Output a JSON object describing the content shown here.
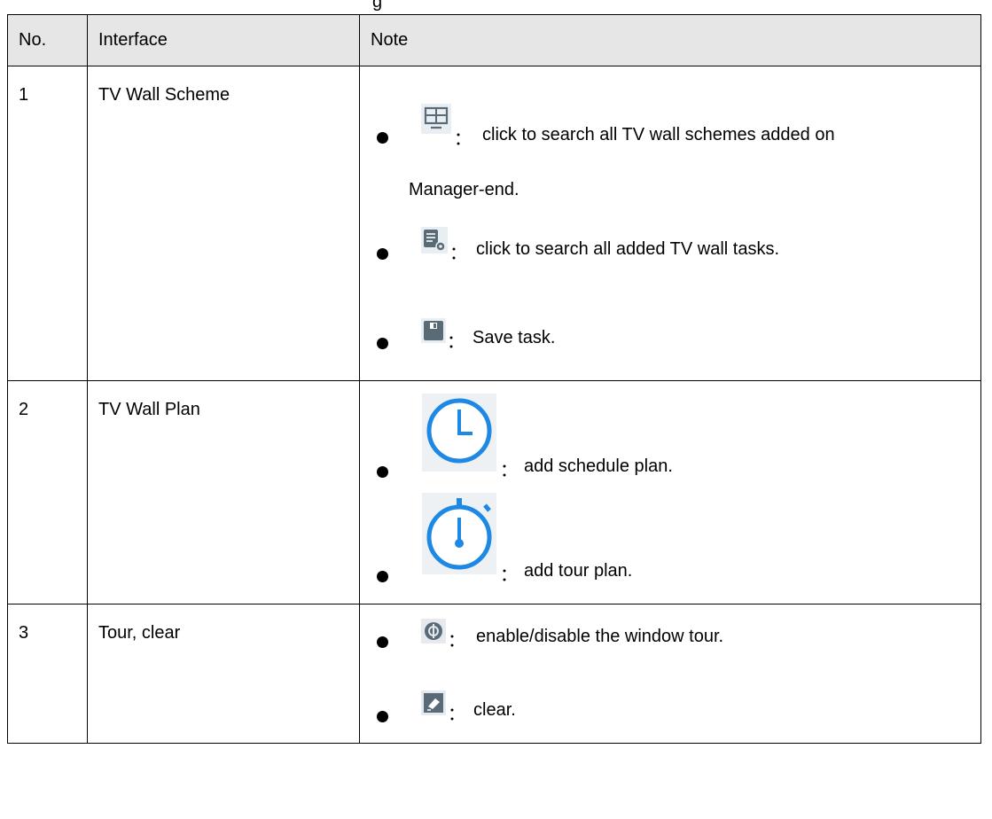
{
  "caption_fragment": "g",
  "headers": {
    "no": "No.",
    "interface": "Interface",
    "note": "Note"
  },
  "rows": [
    {
      "no": "1",
      "interface": "TV Wall Scheme",
      "items": [
        {
          "icon": "tv-wall-scheme-icon",
          "sep": "：",
          "text": "click to search all TV wall schemes added on",
          "text2": "Manager-end."
        },
        {
          "icon": "task-settings-icon",
          "sep": "：",
          "text": "click to search all added TV wall tasks."
        },
        {
          "icon": "save-icon",
          "sep": "：",
          "text": "Save task."
        }
      ]
    },
    {
      "no": "2",
      "interface": "TV Wall Plan",
      "items": [
        {
          "icon": "clock-icon",
          "sep": "：",
          "text": "add schedule plan."
        },
        {
          "icon": "stopwatch-icon",
          "sep": "：",
          "text": "add tour plan."
        }
      ]
    },
    {
      "no": "3",
      "interface": "Tour, clear",
      "items": [
        {
          "icon": "window-tour-icon",
          "sep": "：",
          "text": "enable/disable the window tour."
        },
        {
          "icon": "clear-icon",
          "sep": "：",
          "text": "clear."
        }
      ]
    }
  ],
  "colors": {
    "header_bg": "#e6e6e6",
    "icon_blue": "#1e88e5",
    "icon_grey": "#5a6b78"
  }
}
